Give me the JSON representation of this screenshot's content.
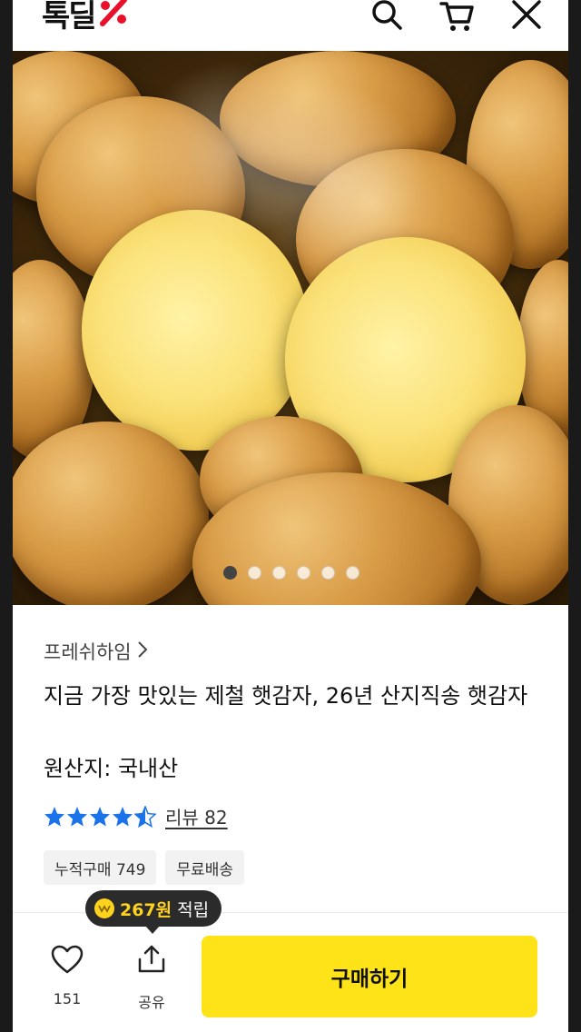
{
  "header": {
    "logo_text": "톡딜",
    "icons": [
      "search-icon",
      "cart-icon",
      "close-icon"
    ]
  },
  "hero": {
    "slide_count": 6,
    "active_slide": 1
  },
  "product": {
    "brand": "프레쉬하임",
    "title": "지금 가장 맛있는 제철 햇감자, 26년 산지직송 햇감자",
    "origin": "원산지: 국내산",
    "rating": 4.5,
    "review_label": "리뷰 82",
    "tags": [
      "누적구매 749",
      "무료배송"
    ]
  },
  "bottom_bar": {
    "point_amount": "267원",
    "point_suffix": "적립",
    "like_count": "151",
    "share_label": "공유",
    "buy_label": "구매하기"
  },
  "colors": {
    "accent_yellow": "#ffe319",
    "star_blue": "#1a73e8",
    "logo_red": "#e8102a"
  }
}
